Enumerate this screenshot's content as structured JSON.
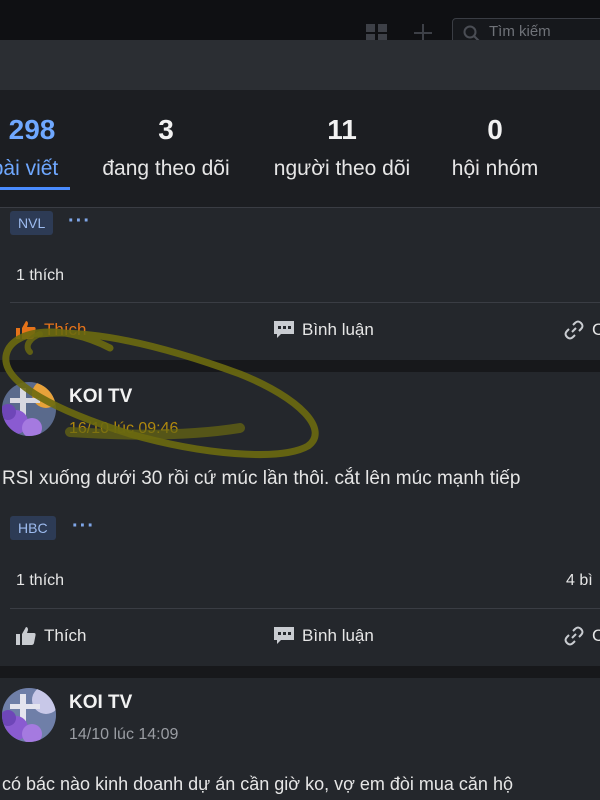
{
  "topbar": {
    "search_placeholder": "Tìm kiếm",
    "icons": [
      "grid-icon",
      "plus-icon",
      "search-icon"
    ]
  },
  "stats": [
    {
      "number": "298",
      "label": "bài viết",
      "active": true
    },
    {
      "number": "3",
      "label": "đang theo dõi"
    },
    {
      "number": "11",
      "label": "người theo dõi"
    },
    {
      "number": "0",
      "label": "hội nhóm"
    }
  ],
  "post1": {
    "tag": "NVL",
    "likes": "1 thích",
    "actions": {
      "like": "Thích",
      "comment": "Bình luận",
      "share": "C"
    }
  },
  "post2": {
    "author": "KOI TV",
    "time": "16/10 lúc 09:46",
    "body": "RSI xuống dưới 30 rồi cứ múc lần thôi. cắt lên múc mạnh tiếp",
    "tag": "HBC",
    "likes": "1 thích",
    "comments": "4 bì",
    "actions": {
      "like": "Thích",
      "comment": "Bình luận",
      "share": "C"
    }
  },
  "post3": {
    "author": "KOI TV",
    "time": "14/10 lúc 14:09",
    "body": "có bác nào kinh doanh dự án cần giờ ko, vợ em đòi mua căn hộ"
  },
  "colors": {
    "accent": "#6fa8ff",
    "liked": "#e5731a",
    "annotation": "#6b6a10"
  }
}
